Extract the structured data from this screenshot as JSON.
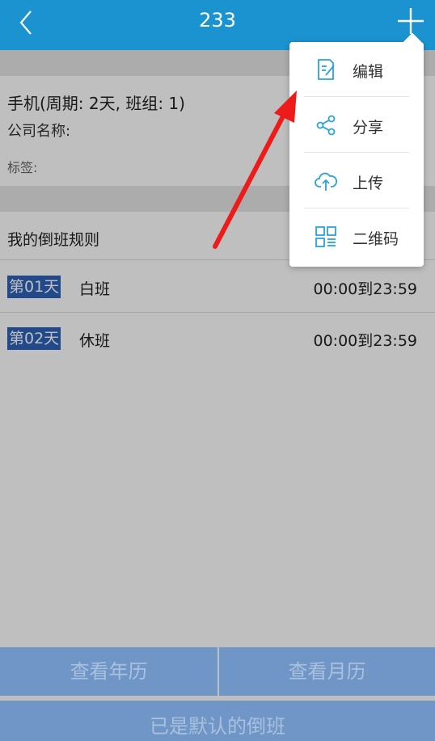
{
  "header": {
    "title": "233"
  },
  "info": {
    "line1": "手机(周期: 2天, 班组: 1)",
    "company_label": "公司名称:",
    "tag_label": "标签:"
  },
  "rules": {
    "header": "我的倒班规则",
    "rows": [
      {
        "day": "第01天",
        "shift": "白班",
        "time": "00:00到23:59"
      },
      {
        "day": "第02天",
        "shift": "休班",
        "time": "00:00到23:59"
      }
    ]
  },
  "footer": {
    "year_label": "查看年历",
    "month_label": "查看月历",
    "default_label": "已是默认的倒班"
  },
  "menu": {
    "items": [
      {
        "label": "编辑",
        "icon": "edit-icon"
      },
      {
        "label": "分享",
        "icon": "share-icon"
      },
      {
        "label": "上传",
        "icon": "upload-cloud-icon"
      },
      {
        "label": "二维码",
        "icon": "qr-code-icon"
      }
    ]
  },
  "colors": {
    "header_bg": "#1b93d0",
    "icon_blue": "#29a3dc",
    "button_bg": "#6f96c7",
    "day_highlight": "#2e63b9",
    "arrow_red": "#ee1b1b"
  }
}
